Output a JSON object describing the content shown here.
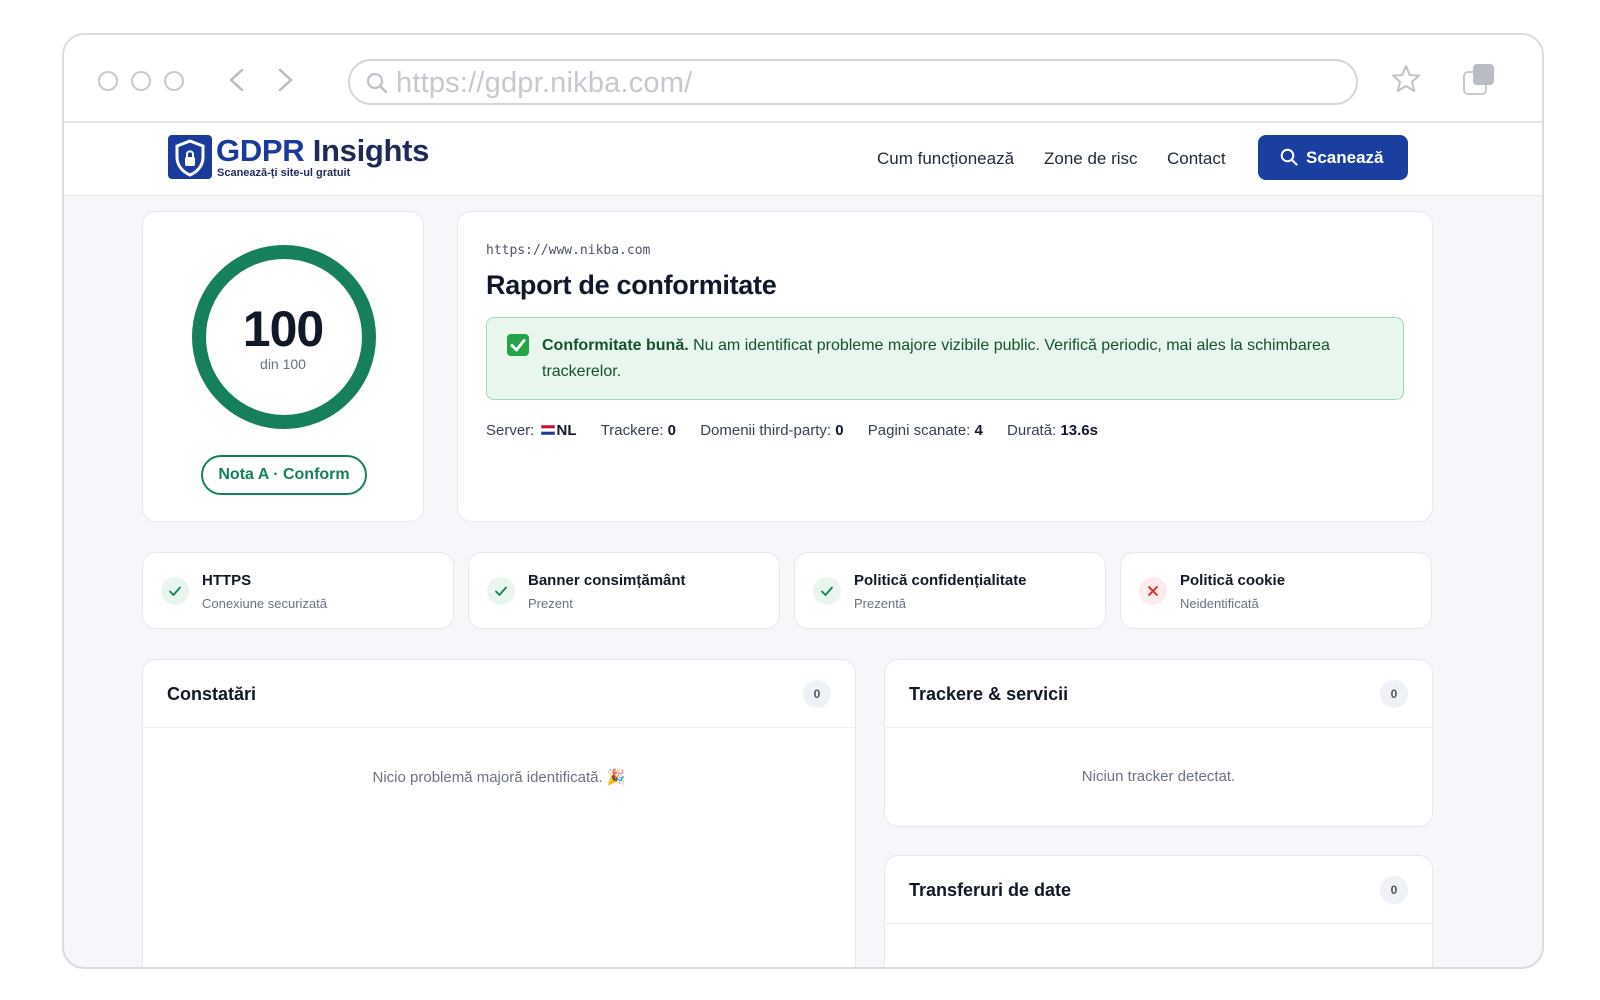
{
  "browser": {
    "url": "https://gdpr.nikba.com/"
  },
  "header": {
    "logo_gdpr": "GDPR",
    "logo_rest": " Insights",
    "logo_tagline": "Scanează-ți site-ul gratuit",
    "nav": [
      "Cum funcționează",
      "Zone de risc",
      "Contact"
    ],
    "scan_label": "Scanează"
  },
  "score": {
    "value": "100",
    "out_of": "din 100",
    "fraction": 1.0,
    "grade": "Nota A · Conform",
    "color": "#15805a"
  },
  "report": {
    "site_url": "https://www.nikba.com",
    "title": "Raport de conformitate",
    "alert_strong": "Conformitate bună.",
    "alert_text": " Nu am identificat probleme majore vizibile public. Verifică periodic, mai ales la schimbarea trackerelor.",
    "meta": {
      "server_label": "Server:",
      "server_value": "NL",
      "trackers_label": "Trackere:",
      "trackers_value": "0",
      "thirdparty_label": "Domenii third-party:",
      "thirdparty_value": "0",
      "pages_label": "Pagini scanate:",
      "pages_value": "4",
      "duration_label": "Durată:",
      "duration_value": "13.6s"
    }
  },
  "checks": [
    {
      "title": "HTTPS",
      "status": "Conexiune securizată",
      "ok": true
    },
    {
      "title": "Banner consimțământ",
      "status": "Prezent",
      "ok": true
    },
    {
      "title": "Politică confidențialitate",
      "status": "Prezentă",
      "ok": true
    },
    {
      "title": "Politică cookie",
      "status": "Neidentificată",
      "ok": false
    }
  ],
  "panels": {
    "findings": {
      "title": "Constatări",
      "count": "0",
      "empty": "Nicio problemă majoră identificată. 🎉"
    },
    "trackers": {
      "title": "Trackere & servicii",
      "count": "0",
      "empty": "Niciun tracker detectat."
    },
    "transfers": {
      "title": "Transferuri de date",
      "count": "0"
    }
  },
  "colors": {
    "brand": "#1a3fa0",
    "success": "#15805a",
    "danger": "#dc2626"
  }
}
